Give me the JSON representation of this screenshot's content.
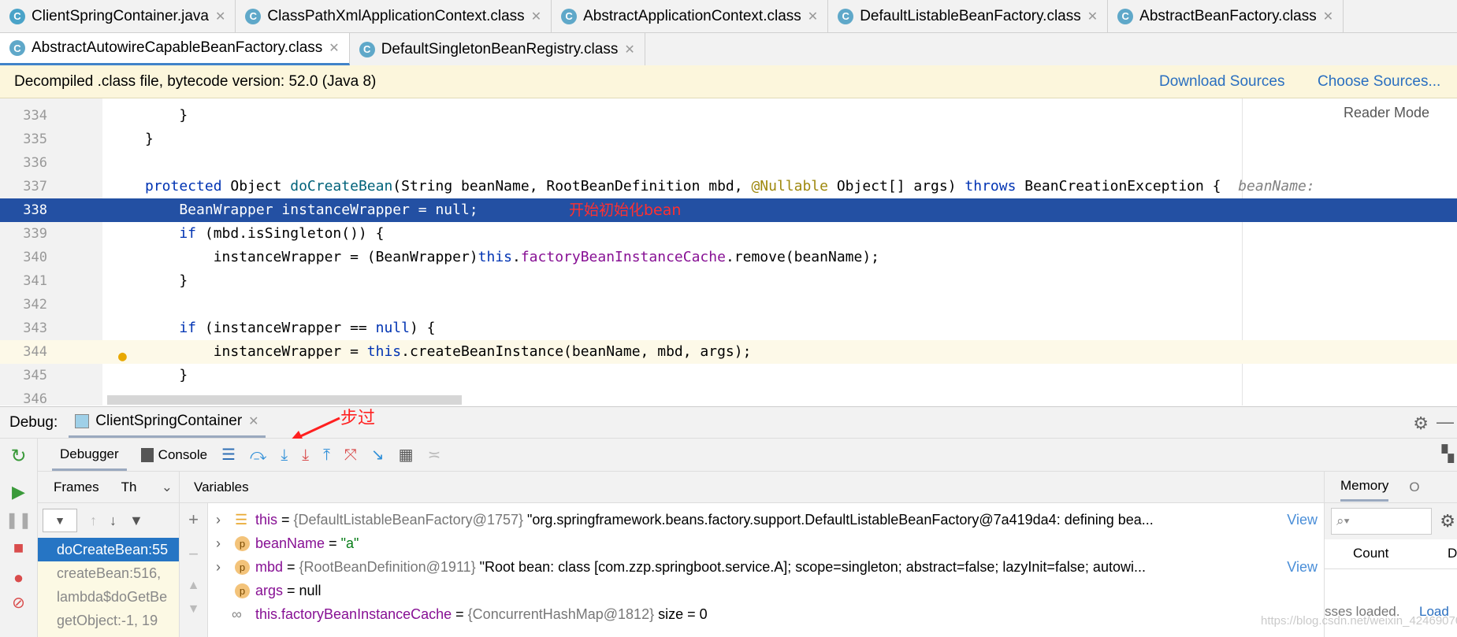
{
  "tabs_row1": [
    {
      "label": "ClientSpringContainer.java",
      "active": false
    },
    {
      "label": "ClassPathXmlApplicationContext.class"
    },
    {
      "label": "AbstractApplicationContext.class"
    },
    {
      "label": "DefaultListableBeanFactory.class"
    },
    {
      "label": "AbstractBeanFactory.class"
    }
  ],
  "tabs_row2": [
    {
      "label": "AbstractAutowireCapableBeanFactory.class",
      "active": true
    },
    {
      "label": "DefaultSingletonBeanRegistry.class"
    }
  ],
  "banner": {
    "text": "Decompiled .class file, bytecode version: 52.0 (Java 8)",
    "download": "Download Sources",
    "choose": "Choose Sources..."
  },
  "reader_mode": "Reader Mode",
  "code": {
    "lines": [
      "334",
      "335",
      "336",
      "337",
      "338",
      "339",
      "340",
      "341",
      "342",
      "343",
      "344",
      "345",
      "346"
    ],
    "l334": "    }",
    "l335": "}",
    "l337a": "protected",
    "l337b": " Object ",
    "l337c": "doCreateBean",
    "l337d": "(String beanName, RootBeanDefinition mbd, ",
    "l337e": "@Nullable",
    "l337f": " Object[] args) ",
    "l337g": "throws",
    "l337h": " BeanCreationException {",
    "l337hint": "beanName: ",
    "l338": "    BeanWrapper instanceWrapper = null;",
    "l339a": "    if",
    "l339b": " (mbd.isSingleton()) {",
    "l340a": "        instanceWrapper = (BeanWrapper)",
    "l340b": "this",
    ".": "",
    "l340c": ".",
    "l340d": "factoryBeanInstanceCache",
    "l340e": ".remove(beanName);",
    "l341": "    }",
    "l343a": "    if",
    "l343b": " (instanceWrapper == ",
    "l343c": "null",
    "l343d": ") {",
    "l344a": "        instanceWrapper = ",
    "l344b": "this",
    "l344c": ".createBeanInstance(beanName, mbd, args);",
    "l345": "    }"
  },
  "annotations": {
    "init": "开始初始化bean",
    "step_over": "步过"
  },
  "debug": {
    "label": "Debug:",
    "session": "ClientSpringContainer",
    "tabs": [
      "Debugger",
      "Console"
    ],
    "frames_tab": "Frames",
    "threads_tab": "Th",
    "variables_tab": "Variables",
    "memory_tab": "Memory",
    "overhead_tab": "O",
    "frames": [
      "doCreateBean:55",
      "createBean:516,",
      "lambda$doGetBe",
      "getObject:-1, 19"
    ],
    "variables": [
      {
        "name": "this",
        "eq": " = ",
        "type": "{DefaultListableBeanFactory@1757}",
        "value": " \"org.springframework.beans.factory.support.DefaultListableBeanFactory@7a419da4: defining bea...",
        "view": "View",
        "icon": "field-list"
      },
      {
        "name": "beanName",
        "eq": " = ",
        "type": "",
        "value": "\"a\"",
        "icon": "p"
      },
      {
        "name": "mbd",
        "eq": " = ",
        "type": "{RootBeanDefinition@1911}",
        "value": " \"Root bean: class [com.zzp.springboot.service.A]; scope=singleton; abstract=false; lazyInit=false; autowi...",
        "view": "View",
        "icon": "p"
      },
      {
        "name": "args",
        "eq": " = ",
        "type": "",
        "value": "null",
        "icon": "p"
      },
      {
        "name": "this.factoryBeanInstanceCache",
        "eq": " = ",
        "type": "{ConcurrentHashMap@1812}",
        "value": "  size = 0",
        "icon": "watch"
      }
    ],
    "memory": {
      "count_col": "Count",
      "d_col": "D",
      "status": "sses loaded.",
      "load": "Load"
    }
  },
  "watermark": "https://blog.csdn.net/weixin_42469070"
}
